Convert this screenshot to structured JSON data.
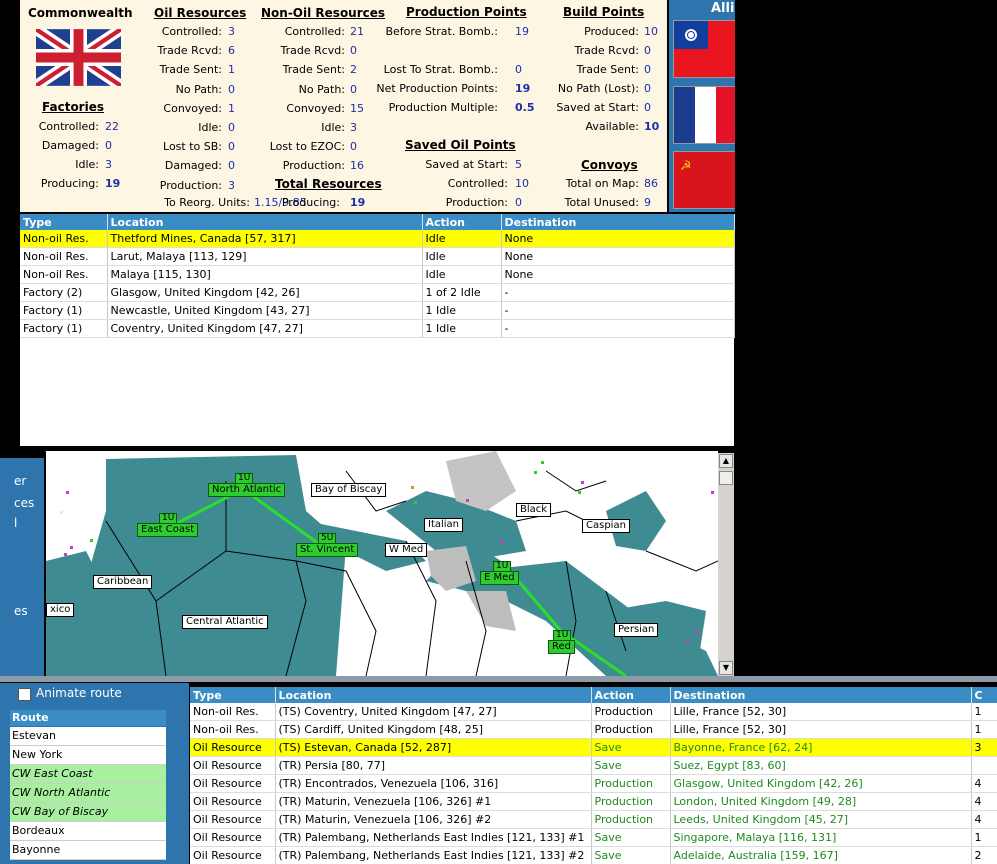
{
  "nation": "Commonwealth",
  "alli_label": "Alli",
  "factories": {
    "heading": "Factories",
    "rows": [
      {
        "label": "Controlled:",
        "value": "22"
      },
      {
        "label": "Damaged:",
        "value": "0"
      },
      {
        "label": "Idle:",
        "value": "3"
      },
      {
        "label": "Producing:",
        "value": "19"
      }
    ]
  },
  "oil": {
    "heading": "Oil Resources",
    "rows": [
      {
        "label": "Controlled:",
        "value": "3"
      },
      {
        "label": "Trade Rcvd:",
        "value": "6"
      },
      {
        "label": "Trade Sent:",
        "value": "1"
      },
      {
        "label": "No Path:",
        "value": "0"
      },
      {
        "label": "Convoyed:",
        "value": "1"
      },
      {
        "label": "Idle:",
        "value": "0"
      },
      {
        "label": "Lost to SB:",
        "value": "0"
      },
      {
        "label": "Damaged:",
        "value": "0"
      },
      {
        "label": "Production:",
        "value": "3"
      }
    ],
    "reorg_label": "To Reorg. Units:",
    "reorg_value": "1.15/9.85"
  },
  "nonoil": {
    "heading": "Non-Oil Resources",
    "rows": [
      {
        "label": "Controlled:",
        "value": "21"
      },
      {
        "label": "Trade Rcvd:",
        "value": "0"
      },
      {
        "label": "Trade Sent:",
        "value": "2"
      },
      {
        "label": "No Path:",
        "value": "0"
      },
      {
        "label": "Convoyed:",
        "value": "15"
      },
      {
        "label": "Idle:",
        "value": "3"
      },
      {
        "label": "Lost to EZOC:",
        "value": "0"
      },
      {
        "label": "Production:",
        "value": "16"
      }
    ]
  },
  "total_resources": {
    "heading": "Total Resources",
    "label": "Producing:",
    "value": "19"
  },
  "production_points": {
    "heading": "Production Points",
    "rows": [
      {
        "label": "Before Strat. Bomb.:",
        "value": "19"
      },
      {
        "label": "Lost To Strat. Bomb.:",
        "value": "0"
      },
      {
        "label": "Net Production Points:",
        "value": "19"
      },
      {
        "label": "Production Multiple:",
        "value": "0.5"
      }
    ]
  },
  "saved_oil": {
    "heading": "Saved Oil Points",
    "rows": [
      {
        "label": "Saved at Start:",
        "value": "5"
      },
      {
        "label": "Controlled:",
        "value": "10"
      },
      {
        "label": "Production:",
        "value": "0"
      }
    ]
  },
  "build_points": {
    "heading": "Build Points",
    "rows": [
      {
        "label": "Produced:",
        "value": "10"
      },
      {
        "label": "Trade Rcvd:",
        "value": "0"
      },
      {
        "label": "Trade Sent:",
        "value": "0"
      },
      {
        "label": "No Path (Lost):",
        "value": "0"
      },
      {
        "label": "Saved at Start:",
        "value": "0"
      },
      {
        "label": "Available:",
        "value": "10"
      }
    ]
  },
  "convoys": {
    "heading": "Convoys",
    "rows": [
      {
        "label": "Total on Map:",
        "value": "86"
      },
      {
        "label": "Total Unused:",
        "value": "9"
      }
    ]
  },
  "resource_table": {
    "headers": [
      "Type",
      "Location",
      "Action",
      "Destination"
    ],
    "rows": [
      [
        "Non-oil Res.",
        "Thetford Mines, Canada [57, 317]",
        "Idle",
        "None"
      ],
      [
        "Non-oil Res.",
        "Larut, Malaya [113, 129]",
        "Idle",
        "None"
      ],
      [
        "Non-oil Res.",
        "Malaya [115, 130]",
        "Idle",
        "None"
      ],
      [
        "Factory (2)",
        "Glasgow, United Kingdom [42, 26]",
        "1 of 2 Idle",
        "-"
      ],
      [
        "Factory (1)",
        "Newcastle, United Kingdom [43, 27]",
        "1 Idle",
        "-"
      ],
      [
        "Factory (1)",
        "Coventry, United Kingdom [47, 27]",
        "1 Idle",
        "-"
      ]
    ],
    "selected_row": 0
  },
  "map": {
    "labels": [
      "North Atlantic",
      "East Coast",
      "Bay of Biscay",
      "St. Vincent",
      "W Med",
      "Italian",
      "Black",
      "Caspian",
      "E Med",
      "Caribbean",
      "Central Atlantic",
      "Persian",
      "Red",
      "xico"
    ],
    "convoy_counts": [
      "1U",
      "1U",
      "5U",
      "1U",
      "1U"
    ],
    "left_strip_text": [
      "er",
      "ces",
      "l",
      "es"
    ]
  },
  "route_panel": {
    "animate_label": "Animate route",
    "header": "Route",
    "items": [
      {
        "label": "Estevan",
        "style": "plain"
      },
      {
        "label": "New York",
        "style": "plain"
      },
      {
        "label": "CW East Coast",
        "style": "sea"
      },
      {
        "label": "CW North Atlantic",
        "style": "sea"
      },
      {
        "label": "CW Bay of Biscay",
        "style": "sea"
      },
      {
        "label": "Bordeaux",
        "style": "plain"
      },
      {
        "label": "Bayonne",
        "style": "plain"
      }
    ]
  },
  "trade_table": {
    "headers": [
      "Type",
      "Location",
      "Action",
      "Destination",
      "C"
    ],
    "rows": [
      [
        "Non-oil Res.",
        "(TS) Coventry, United Kingdom [47, 27]",
        "Production",
        "Lille, France [52, 30]",
        "1"
      ],
      [
        "Non-oil Res.",
        "(TS) Cardiff, United Kingdom [48, 25]",
        "Production",
        "Lille, France [52, 30]",
        "1"
      ],
      [
        "Oil Resource",
        "(TS) Estevan, Canada [52, 287]",
        "Save",
        "Bayonne, France [62, 24]",
        "3"
      ],
      [
        "Oil Resource",
        "(TR) Persia [80, 77]",
        "Save",
        "Suez, Egypt [83, 60]",
        ""
      ],
      [
        "Oil Resource",
        "(TR) Encontrados, Venezuela [106, 316]",
        "Production",
        "Glasgow, United Kingdom [42, 26]",
        "4"
      ],
      [
        "Oil Resource",
        "(TR) Maturin, Venezuela [106, 326] #1",
        "Production",
        "London, United Kingdom [49, 28]",
        "4"
      ],
      [
        "Oil Resource",
        "(TR) Maturin, Venezuela [106, 326] #2",
        "Production",
        "Leeds, United Kingdom [45, 27]",
        "4"
      ],
      [
        "Oil Resource",
        "(TR) Palembang, Netherlands East Indies [121, 133] #1",
        "Save",
        "Singapore, Malaya [116, 131]",
        "1"
      ],
      [
        "Oil Resource",
        "(TR) Palembang, Netherlands East Indies [121, 133] #2",
        "Save",
        "Adelaide, Australia [159, 167]",
        "2"
      ]
    ],
    "selected_row": 2,
    "green_rows": [
      3,
      4,
      5,
      6,
      7,
      8
    ]
  },
  "colors": {
    "panel_bg": "#fdf6e2",
    "value_blue": "#1c2ea8",
    "header_blue": "#3a8dc4",
    "selection_yellow": "#ffff00",
    "sea_teal": "#3e8c92",
    "route_green": "#2ecc2e"
  }
}
